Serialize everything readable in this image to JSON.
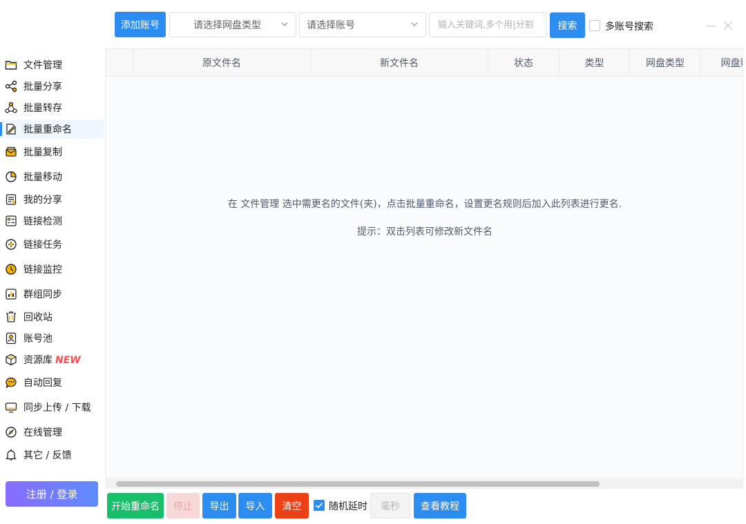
{
  "toolbar": {
    "add_account": "添加账号",
    "disk_type_select": "请选择网盘类型",
    "account_select": "请选择账号",
    "keyword_placeholder": "输入关键词,多个用|分割",
    "search": "搜索",
    "multi_account_search": "多账号搜索"
  },
  "sidebar": {
    "items": [
      {
        "label": "文件管理",
        "icon": "folder-icon"
      },
      {
        "label": "批量分享",
        "icon": "share-icon"
      },
      {
        "label": "批量转存",
        "icon": "transfer-icon"
      },
      {
        "label": "批量重命名",
        "icon": "rename-icon",
        "active": true
      },
      {
        "label": "批量复制",
        "icon": "copy-icon"
      },
      {
        "label": "批量移动",
        "icon": "move-icon"
      },
      {
        "label": "我的分享",
        "icon": "my-share-icon"
      },
      {
        "label": "链接检测",
        "icon": "link-check-icon"
      },
      {
        "label": "链接任务",
        "icon": "link-task-icon"
      },
      {
        "label": "链接监控",
        "icon": "link-monitor-icon"
      },
      {
        "label": "群组同步",
        "icon": "group-sync-icon"
      },
      {
        "label": "回收站",
        "icon": "trash-icon"
      },
      {
        "label": "账号池",
        "icon": "account-pool-icon"
      },
      {
        "label": "资源库",
        "icon": "resource-box-icon",
        "badge": "NEW"
      },
      {
        "label": "自动回复",
        "icon": "auto-reply-icon"
      },
      {
        "label": "同步上传 / 下载",
        "icon": "sync-upload-icon"
      },
      {
        "label": "在线管理",
        "icon": "compass-icon"
      },
      {
        "label": "其它 / 反馈",
        "icon": "bell-icon"
      }
    ],
    "login": "注册 / 登录"
  },
  "table": {
    "columns": [
      "原文件名",
      "新文件名",
      "状态",
      "类型",
      "网盘类型",
      "网盘账"
    ],
    "empty_hint": "在 文件管理 选中需更名的文件(夹)，点击批量重命名，设置更名规则后加入此列表进行更名.",
    "empty_tip": "提示：双击列表可修改新文件名"
  },
  "bottom": {
    "start": "开始重命名",
    "stop": "停止",
    "export": "导出",
    "import": "导入",
    "clear": "清空",
    "random_delay": "随机延时",
    "delay_unit": "毫秒",
    "tutorial": "查看教程"
  },
  "colors": {
    "primary": "#2d8cf0",
    "success": "#19be6b",
    "danger": "#ed4014",
    "new_badge": "#ff4d4f"
  }
}
